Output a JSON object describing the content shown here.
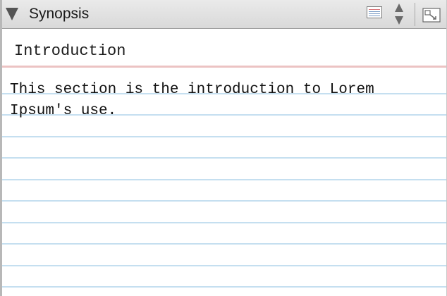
{
  "header": {
    "title": "Synopsis",
    "disclosure_icon": "disclosure-triangle-down-icon",
    "view_mode_icon": "index-card-icon",
    "stepper_icon": "up-down-stepper-icon",
    "expand_icon": "expand-panel-icon"
  },
  "card": {
    "title": "Introduction",
    "synopsis": "This section is the introduction to Lorem\nIpsum's use."
  },
  "colors": {
    "header_bg": "#dcdcdc",
    "card_bg": "#ffffff",
    "ruled_line": "#c5dff0",
    "title_rule": "#ecc3c3"
  }
}
